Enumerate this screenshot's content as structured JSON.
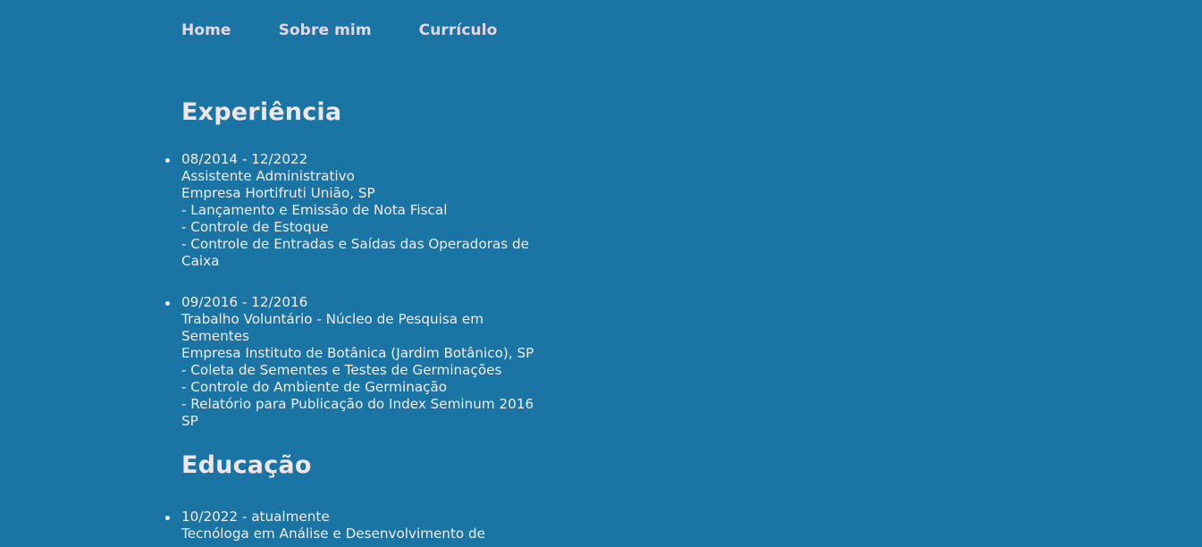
{
  "nav": {
    "items": [
      "Home",
      "Sobre mim",
      "Currículo"
    ]
  },
  "experience": {
    "title": "Experiência",
    "items": [
      {
        "period": "08/2014 - 12/2022",
        "role": "Assistente Administrativo",
        "company": "Empresa Hortifruti União, SP",
        "tasks": [
          "- Lançamento e Emissão de Nota Fiscal",
          "- Controle de Estoque",
          "- Controle de Entradas e Saídas das Operadoras de Caixa"
        ]
      },
      {
        "period": "09/2016 - 12/2016",
        "role": "Trabalho Voluntário - Núcleo de Pesquisa em Sementes",
        "company": "Empresa Instituto de Botânica (Jardim Botânico), SP",
        "tasks": [
          "- Coleta de Sementes e Testes de Germinações",
          "- Controle do Ambiente de Germinação",
          "- Relatório para Publicação do Index Seminum 2016 SP"
        ]
      }
    ]
  },
  "education": {
    "title": "Educação",
    "items": [
      {
        "period": "10/2022 - atualmente",
        "course": "Tecnóloga em Análise e Desenvolvimento de"
      }
    ]
  },
  "colors": {
    "background": "#1a74a4",
    "nav_text": "#ead6e0",
    "body_text": "#f3ecec"
  }
}
